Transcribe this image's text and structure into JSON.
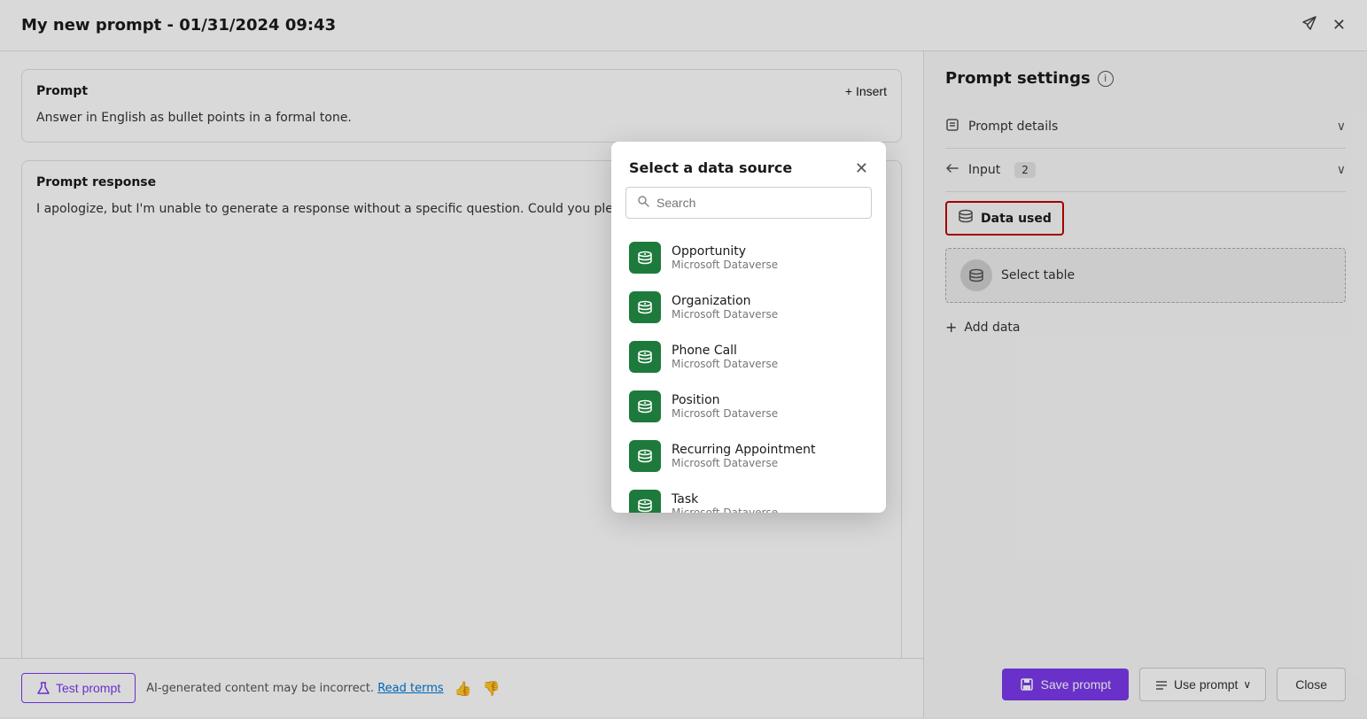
{
  "titleBar": {
    "title": "My new prompt - 01/31/2024 09:43"
  },
  "leftPanel": {
    "promptLabel": "Prompt",
    "insertLabel": "+ Insert",
    "promptText": "Answer in English as bullet points in a formal tone.",
    "responseLabel": "Prompt response",
    "responseText": "I apologize, but I'm unable to generate a response without a specific question. Could you please provide",
    "testPromptLabel": "Test prompt",
    "aiNotice": "AI-generated content may be incorrect.",
    "readTerms": "Read terms"
  },
  "rightPanel": {
    "title": "Prompt settings",
    "promptDetailsLabel": "Prompt details",
    "inputLabel": "Input",
    "inputBadge": "2",
    "dataUsedLabel": "Data used",
    "selectTableLabel": "Select table",
    "addDataLabel": "Add data"
  },
  "modal": {
    "title": "Select a data source",
    "searchPlaceholder": "Search",
    "items": [
      {
        "name": "Opportunity",
        "source": "Microsoft Dataverse"
      },
      {
        "name": "Organization",
        "source": "Microsoft Dataverse"
      },
      {
        "name": "Phone Call",
        "source": "Microsoft Dataverse"
      },
      {
        "name": "Position",
        "source": "Microsoft Dataverse"
      },
      {
        "name": "Recurring Appointment",
        "source": "Microsoft Dataverse"
      },
      {
        "name": "Task",
        "source": "Microsoft Dataverse"
      }
    ]
  },
  "footerActions": {
    "savePrompt": "Save prompt",
    "usePrompt": "Use prompt",
    "close": "Close"
  }
}
